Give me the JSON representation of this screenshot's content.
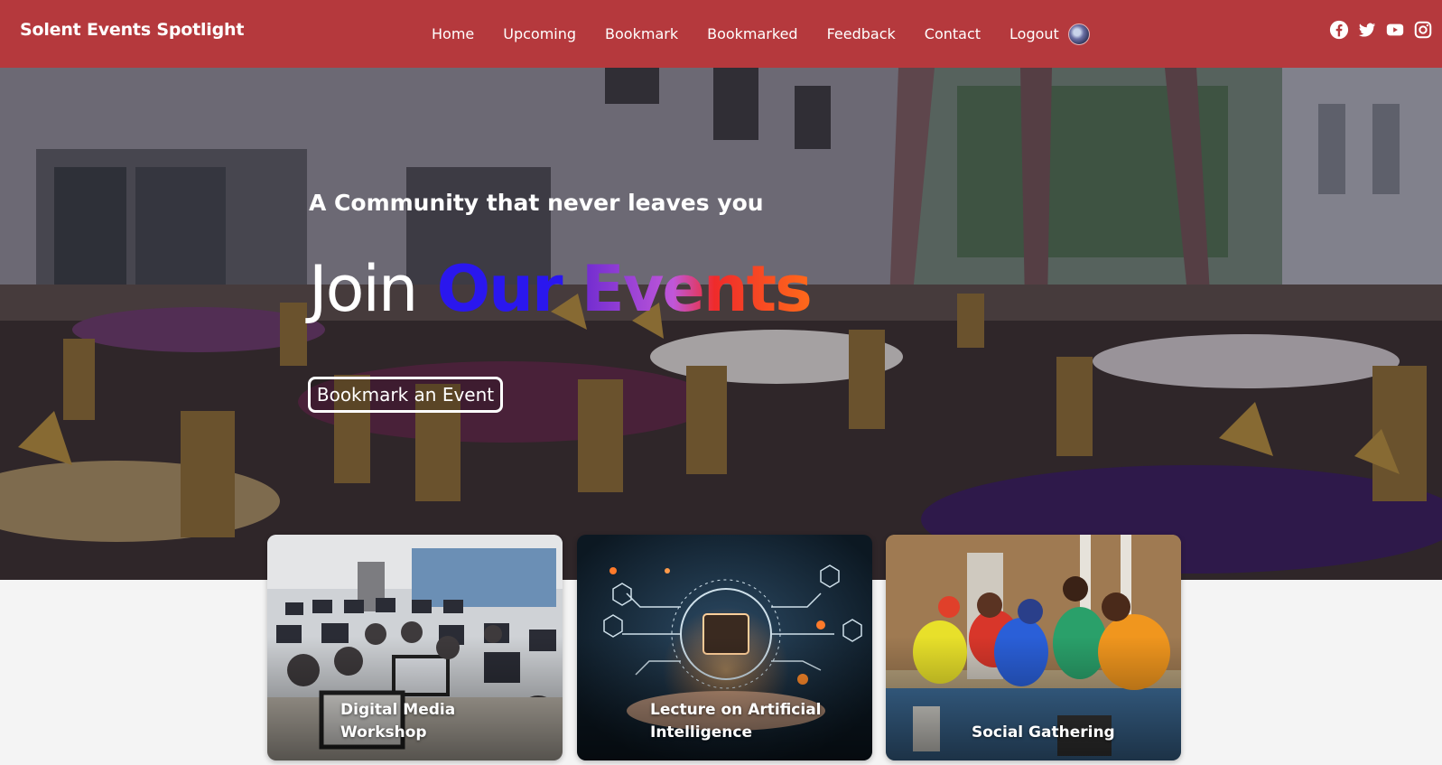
{
  "nav": {
    "brand": "Solent Events Spotlight",
    "links": [
      "Home",
      "Upcoming",
      "Bookmark",
      "Bookmarked",
      "Feedback",
      "Contact",
      "Logout"
    ],
    "social_icons": [
      "facebook-icon",
      "twitter-icon",
      "youtube-icon",
      "instagram-icon"
    ]
  },
  "hero": {
    "tagline": "A Community that never leaves you",
    "headline_join": "Join",
    "headline_our": "Our",
    "headline_events": "Events",
    "cta": "Bookmark an Event"
  },
  "cards": [
    {
      "title_line1": "Digital Media",
      "title_line2": "Workshop"
    },
    {
      "title_line1": "Lecture on Artificial",
      "title_line2": "Intelligence"
    },
    {
      "title_line1": "",
      "title_line2": "Social Gathering"
    }
  ],
  "colors": {
    "navbar": "#b5393d",
    "our_word": "#2a17ee",
    "events_gradient": [
      "#6f2bd0",
      "#c057d9",
      "#ef2b2b",
      "#ff6a1a"
    ]
  }
}
